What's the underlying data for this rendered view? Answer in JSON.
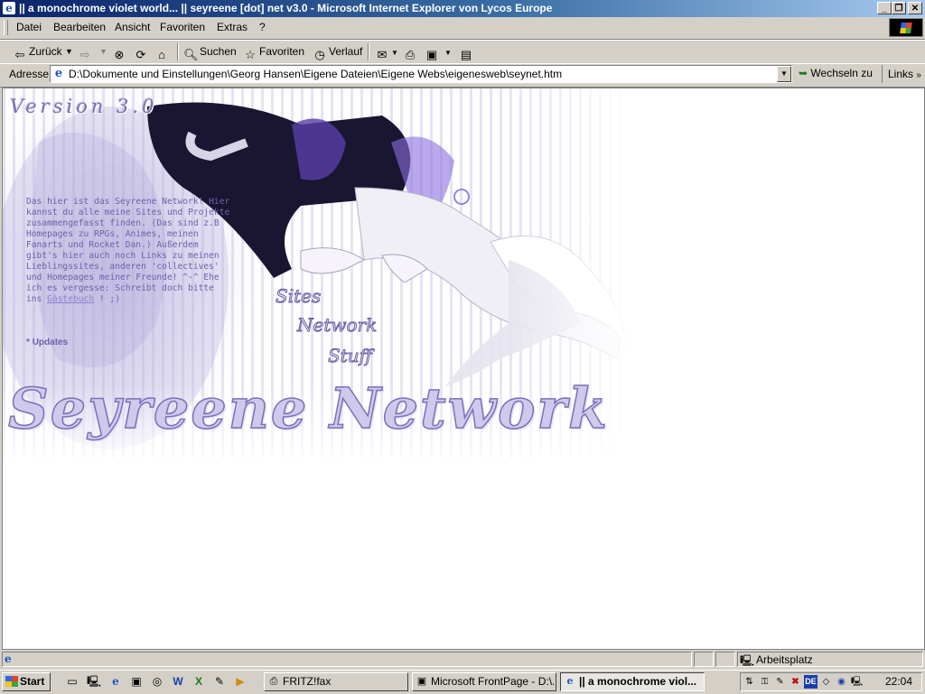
{
  "window": {
    "title": "|| a monochrome violet world... || seyreene [dot] net v3.0 - Microsoft Internet Explorer von Lycos Europe",
    "controls": [
      "minimize-icon",
      "restore-icon",
      "close-icon"
    ]
  },
  "menu": {
    "items": [
      "Datei",
      "Bearbeiten",
      "Ansicht",
      "Favoriten",
      "Extras",
      "?"
    ]
  },
  "toolbar": {
    "back_label": "Zurück",
    "search_label": "Suchen",
    "favorites_label": "Favoriten",
    "history_label": "Verlauf"
  },
  "address": {
    "label": "Adresse",
    "url": "D:\\Dokumente und Einstellungen\\Georg Hansen\\Eigene Dateien\\Eigene Webs\\eigenesweb\\seynet.htm",
    "go_label": "Wechseln zu",
    "links_label": "Links"
  },
  "page": {
    "version": "Version 3.0",
    "intro": "Das hier ist das Seyreene Network! Hier kannst du alle meine Sites und Projekte zusammengefasst finden. (Das sind z.B Homepages zu RPGs, Animes, meinen Fanarts und Rocket Dan.) Außerdem gibt's hier auch noch Links zu meinen Lieblingssites, anderen 'collectives' und Homepages meiner Freunde! ^-^ Ehe ich es vergesse: Schreibt doch bitte ins",
    "guestbook_link": "Gästebuch",
    "intro_end": "! ;)",
    "updates_label": "Updates",
    "nav": [
      "Sites",
      "Network",
      "Stuff"
    ],
    "logo": "Seyreene Network"
  },
  "status": {
    "zone": "Arbeitsplatz"
  },
  "taskbar": {
    "start_label": "Start",
    "tasks": [
      "FRITZ!fax",
      "Microsoft FrontPage - D:\\...",
      "|| a monochrome viol..."
    ],
    "language": "DE",
    "clock": "22:04"
  },
  "colors": {
    "accent_violet": "#6d62aa",
    "title_bar": "#0a246a"
  }
}
